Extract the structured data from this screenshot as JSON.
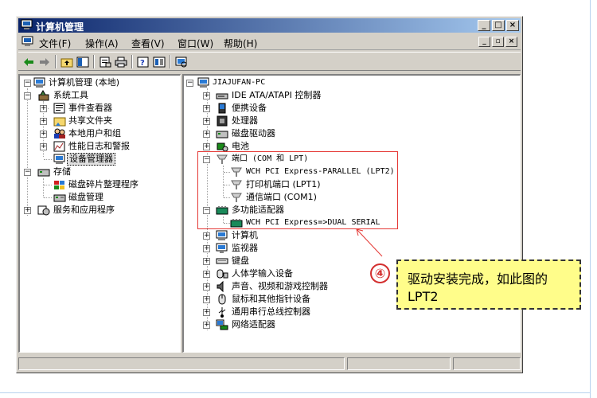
{
  "window": {
    "title": "计算机管理",
    "controls": [
      "_",
      "□",
      "×"
    ]
  },
  "menubar": {
    "items": [
      "文件(F)",
      "操作(A)",
      "查看(V)",
      "窗口(W)",
      "帮助(H)"
    ],
    "mdi_controls": [
      "_",
      "▫",
      "×"
    ]
  },
  "left_tree": {
    "root": "计算机管理 (本地)",
    "system_tools": "系统工具",
    "system_children": [
      "事件查看器",
      "共享文件夹",
      "本地用户和组",
      "性能日志和警报",
      "设备管理器"
    ],
    "storage": "存储",
    "storage_children": [
      "磁盘碎片整理程序",
      "磁盘管理"
    ],
    "services": "服务和应用程序"
  },
  "device_tree": {
    "root": "JIAJUFAN-PC",
    "items_top": [
      "IDE ATA/ATAPI 控制器",
      "便携设备",
      "处理器",
      "磁盘驱动器",
      "电池"
    ],
    "ports": "端口 (COM 和 LPT)",
    "port_children": [
      "WCH PCI Express-PARALLEL (LPT2)",
      "打印机端口 (LPT1)",
      "通信端口 (COM1)"
    ],
    "multifunction": "多功能适配器",
    "multifunction_children": [
      "WCH PCI Express=>DUAL SERIAL"
    ],
    "items_bottom": [
      "计算机",
      "监视器",
      "键盘",
      "人体学输入设备",
      "声音、视频和游戏控制器",
      "鼠标和其他指针设备",
      "通用串行总线控制器",
      "网络适配器"
    ]
  },
  "annotation": {
    "number": "④",
    "text_line1": "驱动安装完成，如此图的",
    "text_line2": "LPT2"
  },
  "colors": {
    "title_start": "#0a246a",
    "title_end": "#a6caf0",
    "highlight": "#e53935",
    "callout_bg": "#fffd8a"
  }
}
